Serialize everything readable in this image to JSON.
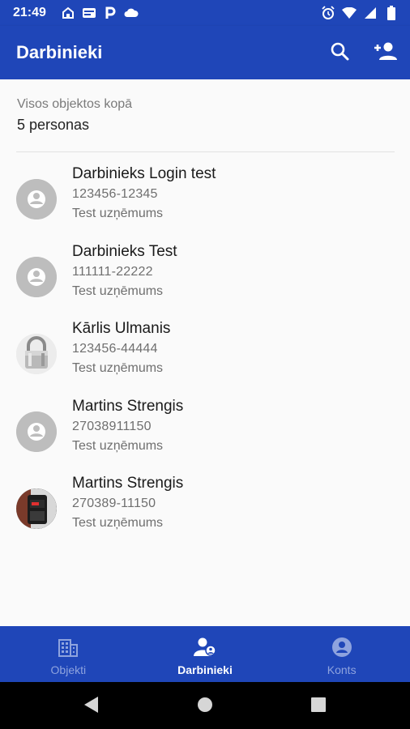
{
  "status_bar": {
    "time": "21:49"
  },
  "app_bar": {
    "title": "Darbinieki",
    "actions": [
      "search-icon",
      "add-person-icon"
    ]
  },
  "summary": {
    "label": "Visos objektos kopā",
    "count": "5 personas"
  },
  "employees": [
    {
      "name": "Darbinieks Login test",
      "code": "123456-12345",
      "company": "Test uzņēmums",
      "avatar": "default-person-icon"
    },
    {
      "name": "Darbinieks Test",
      "code": "111111-22222",
      "company": "Test uzņēmums",
      "avatar": "default-person-icon"
    },
    {
      "name": "Kārlis Ulmanis",
      "code": "123456-44444",
      "company": "Test uzņēmums",
      "avatar": "padlock-photo"
    },
    {
      "name": "Martins Strengis",
      "code": "27038911150",
      "company": "Test uzņēmums",
      "avatar": "default-person-icon"
    },
    {
      "name": "Martins Strengis",
      "code": "270389-11150",
      "company": "Test uzņēmums",
      "avatar": "device-photo"
    }
  ],
  "bottom_nav": {
    "tabs": [
      {
        "label": "Objekti",
        "icon": "building-icon",
        "active": false
      },
      {
        "label": "Darbinieki",
        "icon": "people-icon",
        "active": true
      },
      {
        "label": "Konts",
        "icon": "account-icon",
        "active": false
      }
    ]
  },
  "colors": {
    "primary": "#1f46b8",
    "background": "#fafafa",
    "avatar_grey": "#bdbdbd",
    "inactive_nav": "#8ea3de"
  }
}
